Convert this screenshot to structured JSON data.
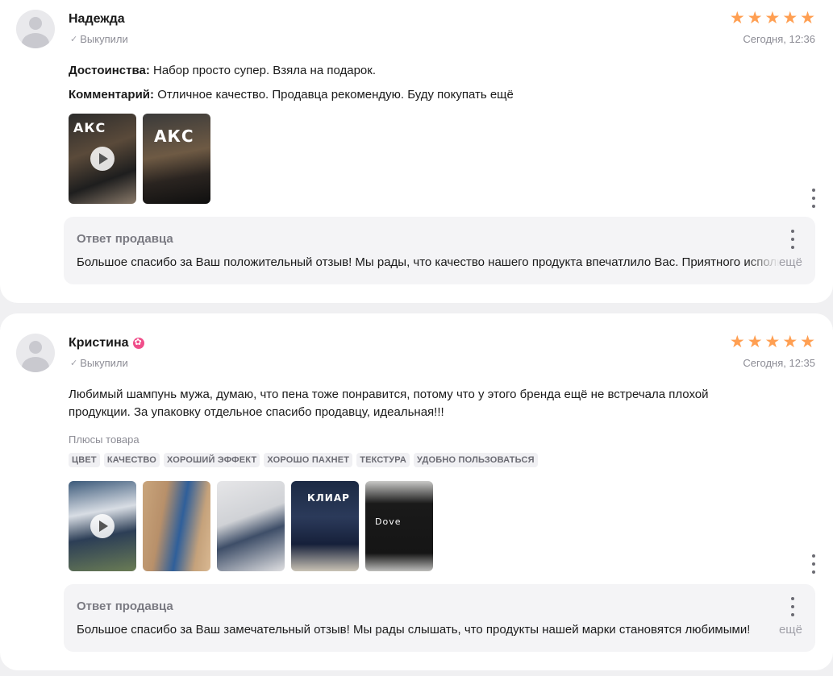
{
  "reviews": [
    {
      "author": "Надежда",
      "bought_label": "Выкупили",
      "rating": 5,
      "date": "Сегодня, 12:36",
      "advantages_label": "Достоинства:",
      "advantages_text": "Набор просто супер. Взяла на подарок.",
      "comment_label": "Комментарий:",
      "comment_text": "Отличное качество. Продавца рекомендую. Буду покупать ещё",
      "photos": [
        {
          "kind": "video",
          "label": "АКС"
        },
        {
          "kind": "photo",
          "label": "АКС"
        }
      ],
      "seller_reply": {
        "title": "Ответ продавца",
        "text": "Большое спасибо за Ваш положительный отзыв! Мы рады, что качество нашего продукта впечатлило Вас. Приятного использования!",
        "more": "ещё"
      }
    },
    {
      "author": "Кристина",
      "bought_label": "Выкупили",
      "rating": 5,
      "date": "Сегодня, 12:35",
      "text_line1": "Любимый шампунь мужа, думаю, что пена тоже понравится, потому что у этого бренда ещё не встречала плохой",
      "text_line2": "продукции. За упаковку отдельное спасибо продавцу, идеальная!!!",
      "pros_label": "Плюсы товара",
      "tags": [
        "Цвет",
        "Качество",
        "Хороший эффект",
        "Хорошо пахнет",
        "Текстура",
        "Удобно пользоваться"
      ],
      "photos": [
        {
          "kind": "video",
          "label": ""
        },
        {
          "kind": "photo",
          "label": ""
        },
        {
          "kind": "photo",
          "label": ""
        },
        {
          "kind": "photo",
          "label": "КЛИАР"
        },
        {
          "kind": "photo",
          "label": "Dove"
        }
      ],
      "seller_reply": {
        "title": "Ответ продавца",
        "text": "Большое спасибо за Ваш замечательный отзыв! Мы рады слышать, что продукты нашей марки становятся любимыми!",
        "more": "ещё"
      }
    }
  ],
  "colors": {
    "star": "#ff9f52",
    "background": "#f0f0f2",
    "seller_box": "#f4f4f6"
  }
}
